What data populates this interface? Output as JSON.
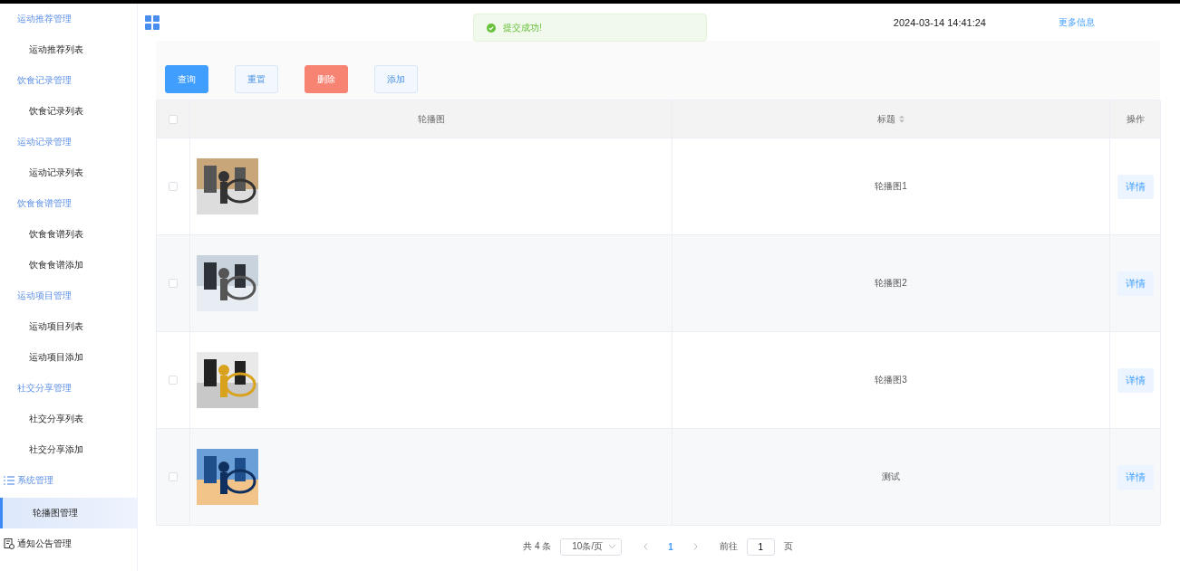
{
  "sidebar": {
    "items": [
      {
        "label": "运动推荐管理",
        "kind": "group",
        "selected": false
      },
      {
        "label": "运动推荐列表",
        "kind": "item",
        "selected": false
      },
      {
        "label": "饮食记录管理",
        "kind": "group",
        "selected": false
      },
      {
        "label": "饮食记录列表",
        "kind": "item",
        "selected": false
      },
      {
        "label": "运动记录管理",
        "kind": "group",
        "selected": false
      },
      {
        "label": "运动记录列表",
        "kind": "item",
        "selected": false
      },
      {
        "label": "饮食食谱管理",
        "kind": "group",
        "selected": false
      },
      {
        "label": "饮食食谱列表",
        "kind": "item",
        "selected": false
      },
      {
        "label": "饮食食谱添加",
        "kind": "item",
        "selected": false
      },
      {
        "label": "运动项目管理",
        "kind": "group",
        "selected": false
      },
      {
        "label": "运动项目列表",
        "kind": "item",
        "selected": false
      },
      {
        "label": "运动项目添加",
        "kind": "item",
        "selected": false
      },
      {
        "label": "社交分享管理",
        "kind": "group",
        "selected": false
      },
      {
        "label": "社交分享列表",
        "kind": "item",
        "selected": false
      },
      {
        "label": "社交分享添加",
        "kind": "item",
        "selected": false
      },
      {
        "label": "系统管理",
        "kind": "system",
        "selected": false
      },
      {
        "label": "轮播图管理",
        "kind": "item",
        "selected": true
      },
      {
        "label": "通知公告管理",
        "kind": "notice",
        "selected": false
      }
    ]
  },
  "header": {
    "datetime": "2024-03-14 14:41:24",
    "more_link": "更多信息"
  },
  "toast": {
    "message": "提交成功!"
  },
  "toolbar": {
    "buttons": [
      {
        "label": "查询",
        "kind": "primary"
      },
      {
        "label": "重置",
        "kind": "plain"
      },
      {
        "label": "删除",
        "kind": "danger"
      },
      {
        "label": "添加",
        "kind": "plain"
      }
    ]
  },
  "table": {
    "all_checked": false,
    "columns": [
      "轮播图",
      "标题",
      "操作"
    ],
    "rows": [
      {
        "checked": false,
        "title": "轮播图1",
        "action": "详情"
      },
      {
        "checked": false,
        "title": "轮播图2",
        "action": "详情"
      },
      {
        "checked": false,
        "title": "轮播图3",
        "action": "详情"
      },
      {
        "checked": false,
        "title": "测试",
        "action": "详情"
      }
    ]
  },
  "pagination": {
    "total": "共 4 条",
    "page_size": "10条/页",
    "current_page": "1",
    "goto_label": "前往",
    "goto_value": "1",
    "page_suffix": "页"
  }
}
